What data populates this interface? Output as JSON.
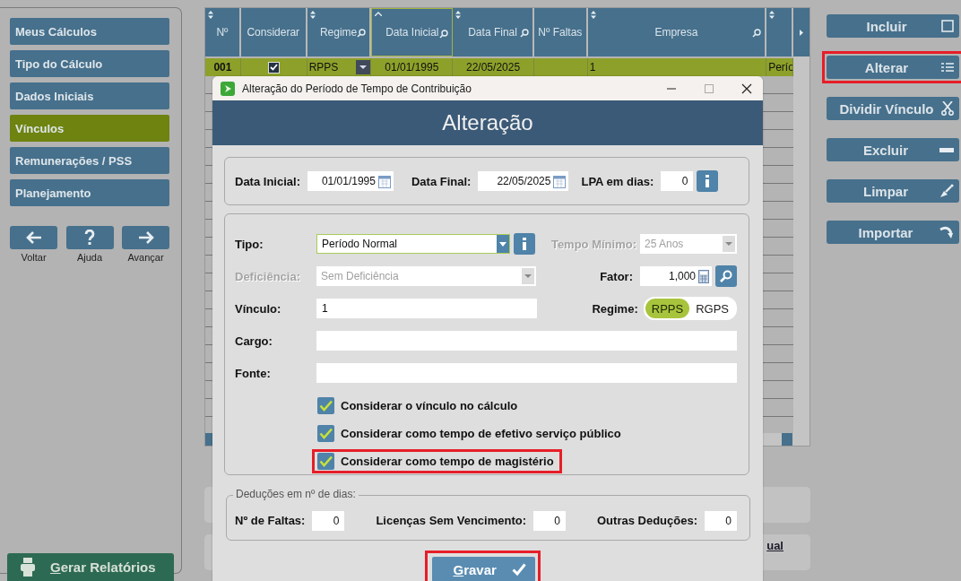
{
  "sidebar": {
    "items": [
      {
        "label": "Meus Cálculos",
        "selected": false
      },
      {
        "label": "Tipo do Cálculo",
        "selected": false
      },
      {
        "label": "Dados Iniciais",
        "selected": false
      },
      {
        "label": "Vínculos",
        "selected": true
      },
      {
        "label": "Remunerações / PSS",
        "selected": false
      },
      {
        "label": "Planejamento",
        "selected": false
      }
    ],
    "nav_buttons": [
      {
        "label": "Voltar",
        "kind": "back"
      },
      {
        "label": "Ajuda",
        "kind": "help"
      },
      {
        "label": "Avançar",
        "kind": "forward"
      }
    ],
    "report_button": "Gerar Relatórios"
  },
  "table": {
    "columns": [
      {
        "label": "Nº",
        "sortable": true,
        "sorted": false,
        "search": false
      },
      {
        "label": "Considerar",
        "sortable": false,
        "sorted": false,
        "search": false
      },
      {
        "label": "Regime",
        "sortable": true,
        "sorted": false,
        "search": true
      },
      {
        "label": "Data Inicial",
        "sortable": true,
        "sorted": true,
        "search": true
      },
      {
        "label": "Data Final",
        "sortable": true,
        "sorted": false,
        "search": true
      },
      {
        "label": "Nº Faltas",
        "sortable": false,
        "sorted": false,
        "search": false
      },
      {
        "label": "Empresa",
        "sortable": true,
        "sorted": false,
        "search": true
      },
      {
        "sortable": true,
        "sorted": false,
        "search": false
      }
    ],
    "rows": [
      {
        "selected": true,
        "cells": [
          {
            "kind": "number",
            "text": "001"
          },
          {
            "kind": "checkbox",
            "checked": true
          },
          {
            "kind": "dropdown",
            "text": "RPPS"
          },
          {
            "kind": "center",
            "text": "01/01/1995"
          },
          {
            "kind": "center",
            "text": "22/05/2025"
          },
          {
            "kind": "empty"
          },
          {
            "kind": "text",
            "text": "1"
          },
          {
            "kind": "text",
            "text": "Perío"
          }
        ]
      }
    ]
  },
  "actions": [
    {
      "label": "Incluir",
      "kind": "add",
      "highlighted": false
    },
    {
      "label": "Alterar",
      "kind": "edit",
      "highlighted": true
    },
    {
      "label": "Dividir Vínculo",
      "kind": "split",
      "highlighted": false
    },
    {
      "label": "Excluir",
      "kind": "delete",
      "highlighted": false
    },
    {
      "label": "Limpar",
      "kind": "clear",
      "highlighted": false
    },
    {
      "label": "Importar",
      "kind": "import",
      "highlighted": false
    }
  ],
  "background_link": "ual",
  "dialog": {
    "title": "Alteração do Período de Tempo de Contribuição",
    "heading": "Alteração",
    "data_inicial": {
      "label": "Data Inicial:",
      "value": "01/01/1995"
    },
    "data_final": {
      "label": "Data Final:",
      "value": "22/05/2025"
    },
    "lpa": {
      "label": "LPA em dias:",
      "value": "0"
    },
    "tipo": {
      "label": "Tipo:",
      "value": "Período Normal"
    },
    "tempo_minimo": {
      "label": "Tempo Mínimo:",
      "value": "25 Anos",
      "disabled": true
    },
    "deficiencia": {
      "label": "Deficiência:",
      "value": "Sem Deficiência",
      "disabled": true
    },
    "fator": {
      "label": "Fator:",
      "value": "1,000"
    },
    "vinculo": {
      "label": "Vínculo:",
      "value": "1"
    },
    "regime": {
      "label": "Regime:",
      "options": [
        {
          "label": "RPPS",
          "selected": true
        },
        {
          "label": "RGPS",
          "selected": false
        }
      ]
    },
    "cargo": {
      "label": "Cargo:"
    },
    "fonte": {
      "label": "Fonte:"
    },
    "checks": [
      {
        "label": "Considerar o vínculo no cálculo",
        "checked": true,
        "highlighted": false
      },
      {
        "label": "Considerar como tempo de efetivo serviço público",
        "checked": true,
        "highlighted": false
      },
      {
        "label": "Considerar como tempo de magistério",
        "checked": true,
        "highlighted": true
      }
    ],
    "deducoes": {
      "legend": "Deduções em nº de dias:",
      "fields": [
        {
          "label": "Nº de Faltas:",
          "value": "0"
        },
        {
          "label": "Licenças Sem Vencimento:",
          "value": "0"
        },
        {
          "label": "Outras Deduções:",
          "value": "0"
        }
      ]
    },
    "save_button": {
      "label": "Gravar",
      "highlighted": true
    }
  }
}
